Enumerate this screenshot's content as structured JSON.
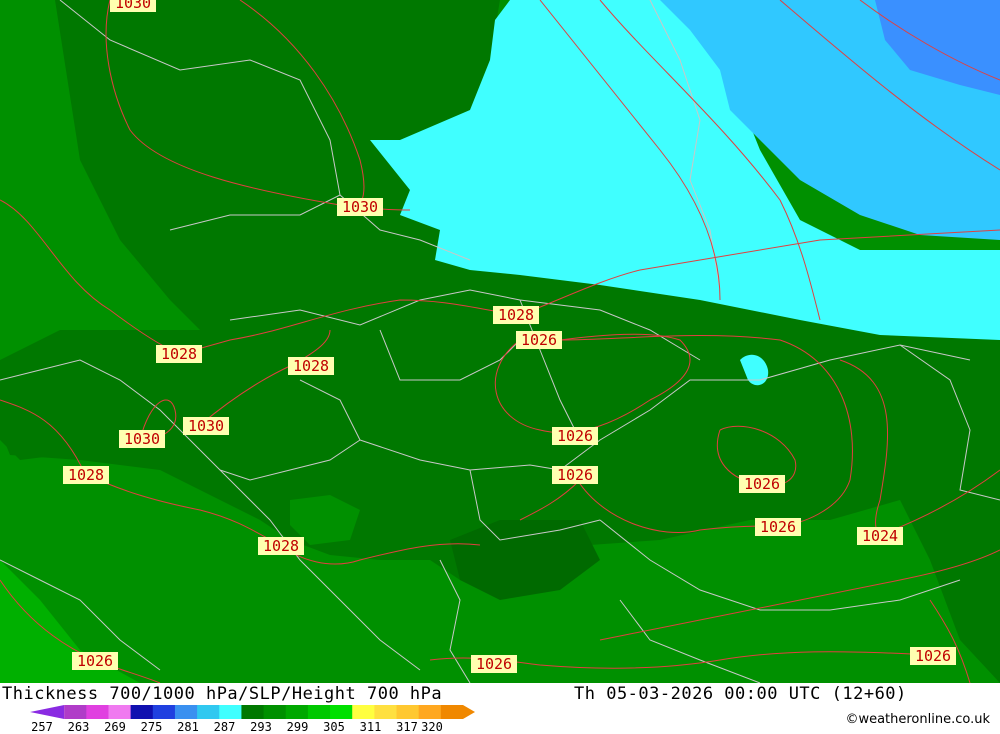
{
  "title": {
    "left": "Thickness 700/1000 hPa/SLP/Height 700 hPa",
    "right": "Th 05-03-2026 00:00 UTC (12+60)"
  },
  "credit": "©weatheronline.co.uk",
  "legend": {
    "ticks": [
      "257",
      "263",
      "269",
      "275",
      "281",
      "287",
      "293",
      "299",
      "305",
      "311",
      "317",
      "320"
    ],
    "colors": [
      "#8a2be2",
      "#b03cc8",
      "#e040e0",
      "#f07af0",
      "#1010b0",
      "#2040e0",
      "#3a90f0",
      "#30c8f0",
      "#40ffff",
      "#007800",
      "#009000",
      "#00a800",
      "#00c800",
      "#00e000",
      "#ffff40",
      "#ffe040",
      "#ffc830",
      "#ffa820",
      "#f08800"
    ]
  },
  "isobars": [
    {
      "text": "1030"
    },
    {
      "text": "1030"
    },
    {
      "text": "1028"
    },
    {
      "text": "1026"
    },
    {
      "text": "1028"
    },
    {
      "text": "1028"
    },
    {
      "text": "1030"
    },
    {
      "text": "1030"
    },
    {
      "text": "1028"
    },
    {
      "text": "1026"
    },
    {
      "text": "1026"
    },
    {
      "text": "1026"
    },
    {
      "text": "1026"
    },
    {
      "text": "1024"
    },
    {
      "text": "1028"
    },
    {
      "text": "1026"
    },
    {
      "text": "1026"
    },
    {
      "text": "1026"
    }
  ],
  "fill_colors": {
    "dark_green": "#007800",
    "mid_green": "#009000",
    "light_green": "#00a800",
    "bright_green": "#00c000",
    "cyan": "#40ffff",
    "sky_blue": "#30c8ff",
    "blue": "#3a90ff",
    "isobar_line": "#e04040",
    "border_line": "#c8c8c8"
  }
}
